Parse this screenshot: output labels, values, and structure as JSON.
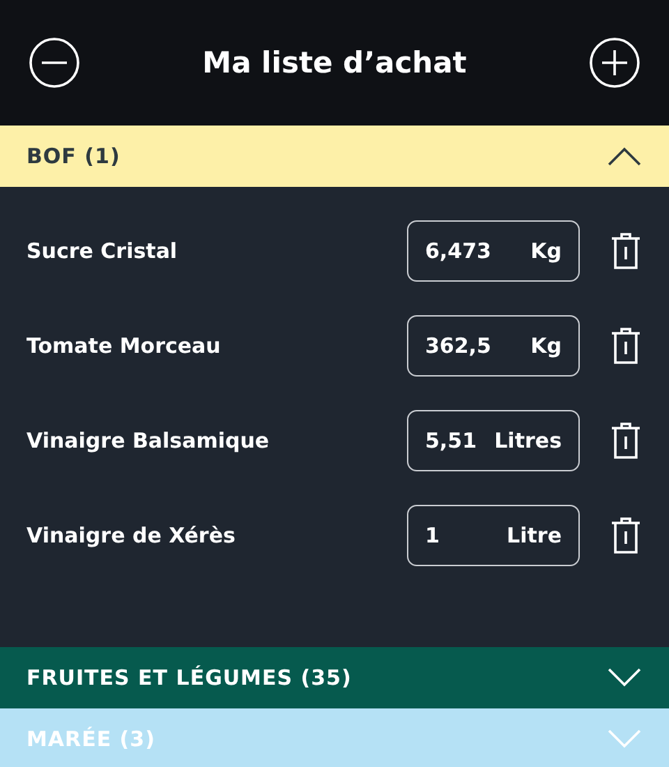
{
  "header": {
    "title": "Ma liste d’achat"
  },
  "sections": [
    {
      "name": "BOF (1)",
      "color": "#fdf0a8",
      "expanded": true,
      "items": [
        {
          "name": "Sucre Cristal",
          "quantity": "6,473",
          "unit": "Kg"
        },
        {
          "name": "Tomate Morceau",
          "quantity": "362,5",
          "unit": "Kg"
        },
        {
          "name": "Vinaigre Balsamique",
          "quantity": "5,51",
          "unit": "Litres"
        },
        {
          "name": "Vinaigre de Xérès",
          "quantity": "1",
          "unit": "Litre"
        }
      ]
    },
    {
      "name": "FRUITES ET LÉGUMES (35)",
      "color": "#065a4e",
      "expanded": false
    },
    {
      "name": "MARÉE (3)",
      "color": "#b5e1f5",
      "expanded": false
    }
  ]
}
